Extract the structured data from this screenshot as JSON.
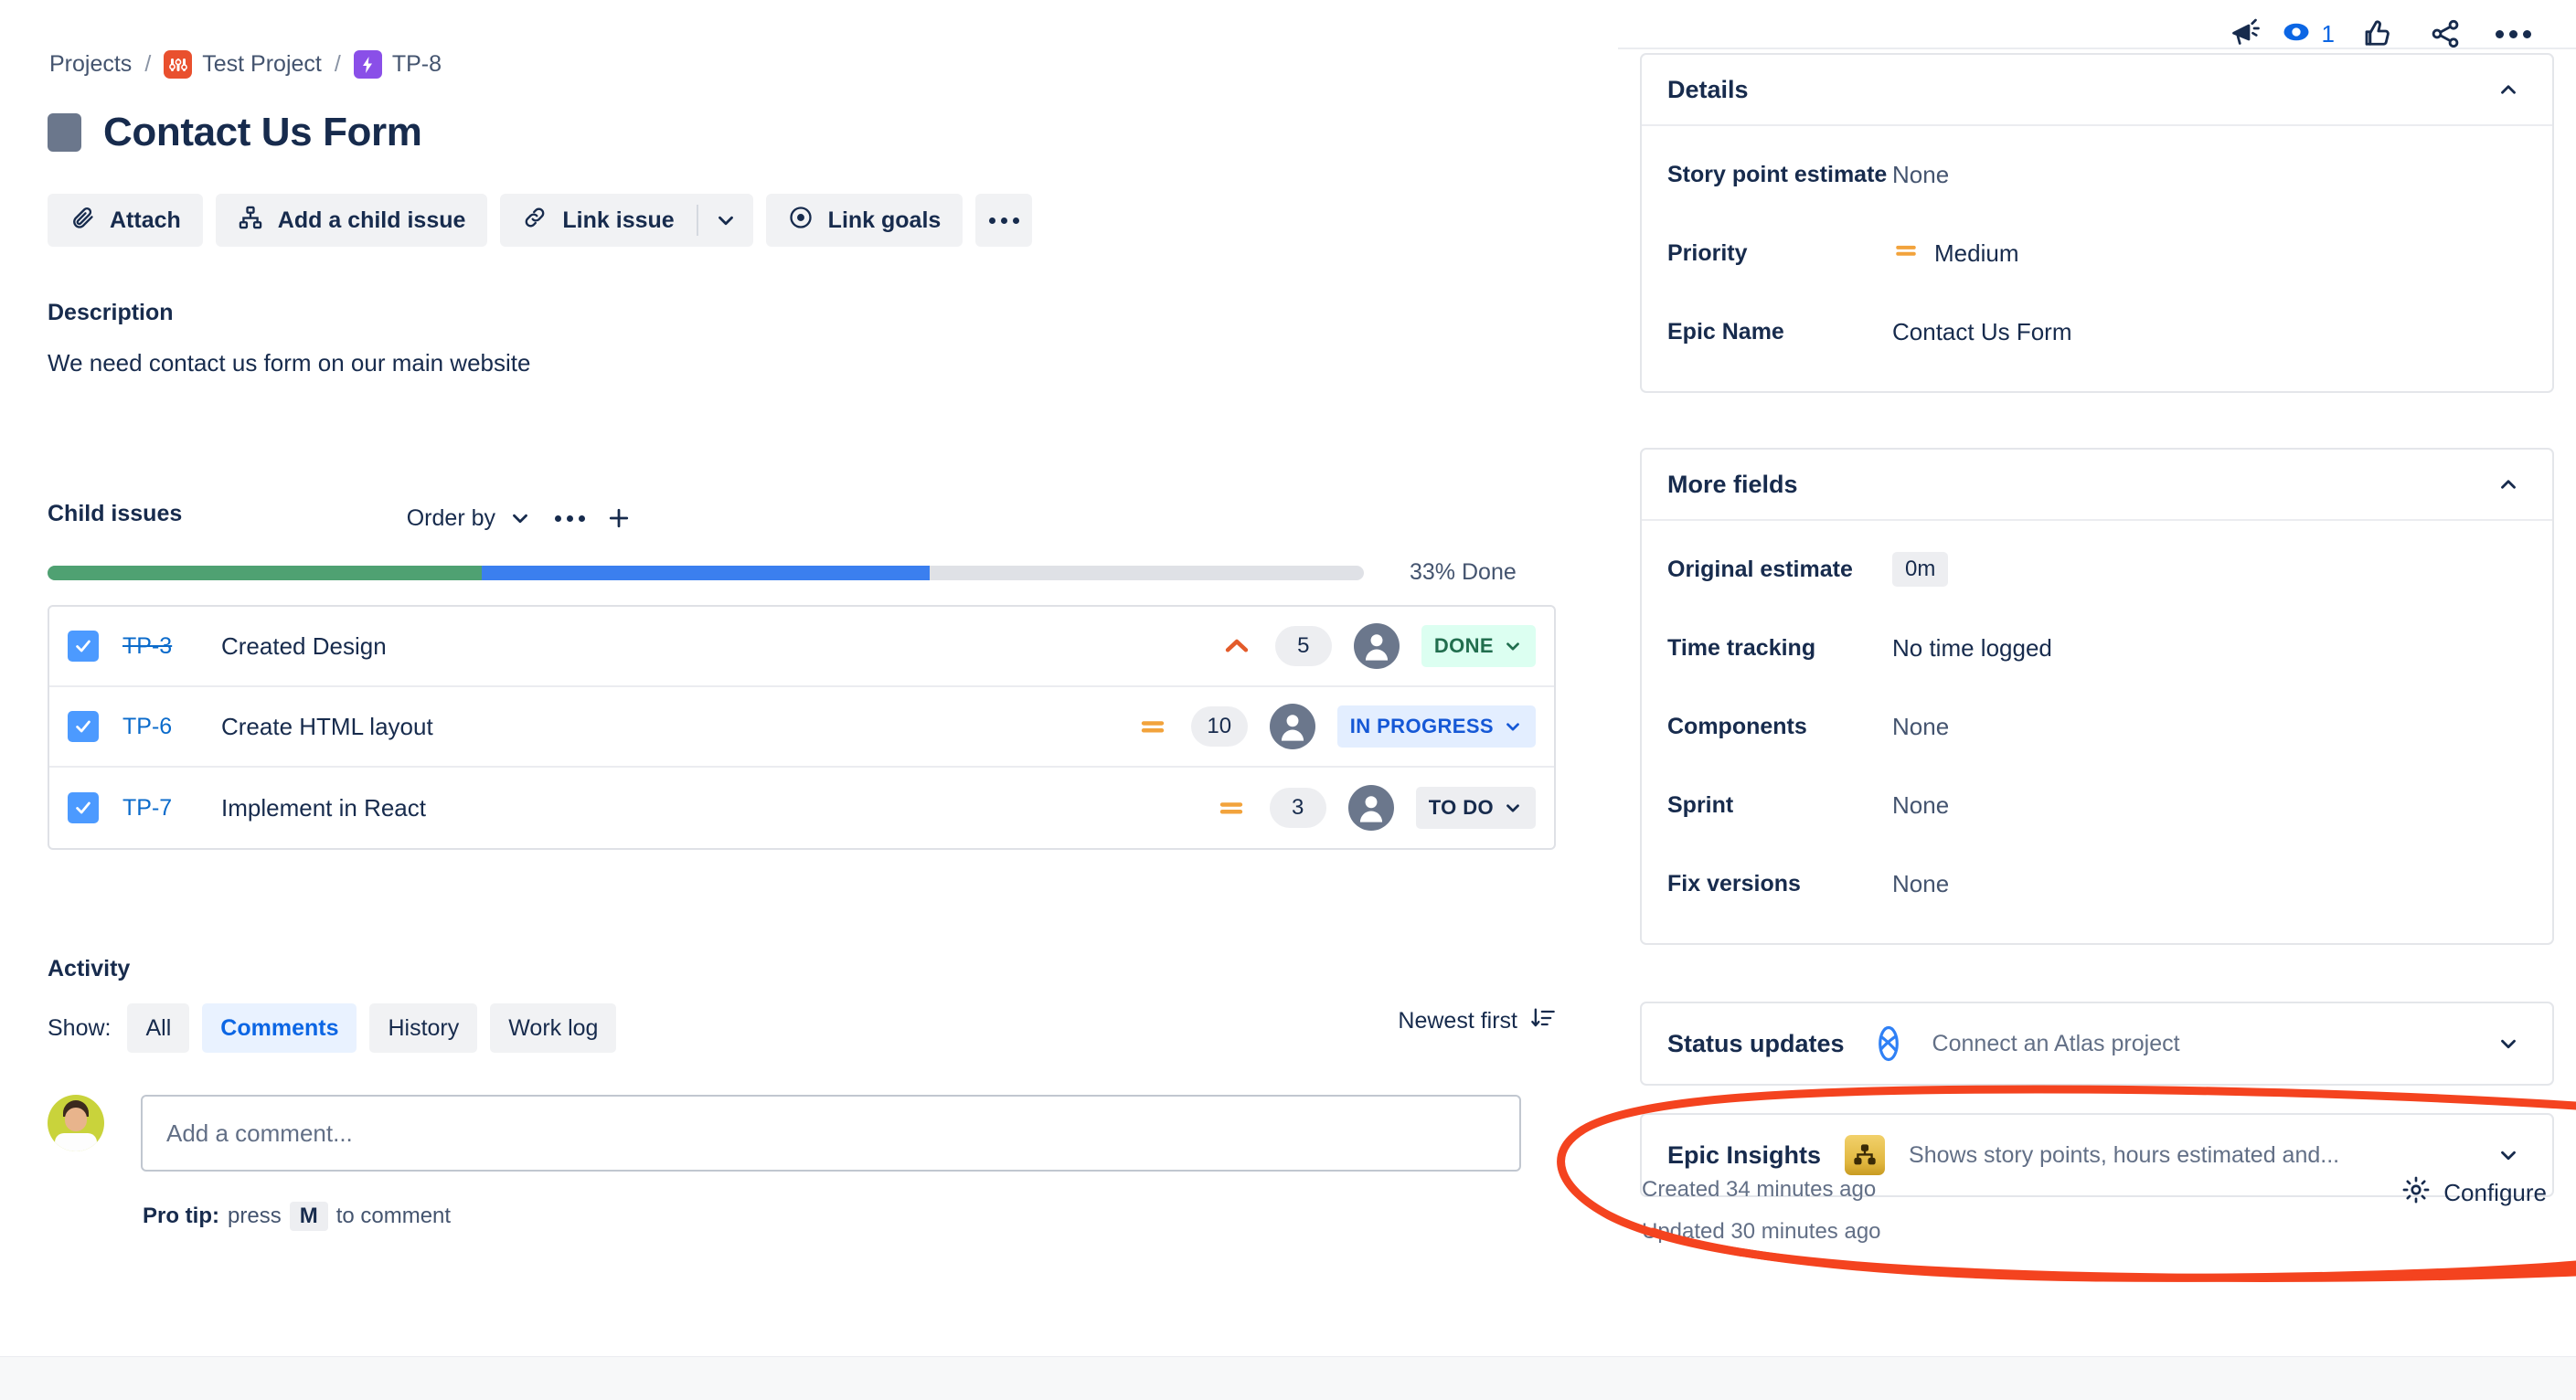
{
  "breadcrumb": {
    "projects_label": "Projects",
    "sep": "/",
    "project_name": "Test Project",
    "issue_key": "TP-8",
    "project_icon": "project-board-icon",
    "epic_icon": "epic-bolt-icon"
  },
  "header": {
    "title": "Contact Us Form",
    "type_icon": "epic-square-icon"
  },
  "toolbar": {
    "attach_label": "Attach",
    "attach_icon": "paperclip-icon",
    "add_child_label": "Add a child issue",
    "add_child_icon": "child-issue-tree-icon",
    "link_issue_label": "Link issue",
    "link_issue_icon": "link-chain-icon",
    "link_caret_icon": "chevron-down-icon",
    "link_goals_label": "Link goals",
    "link_goals_icon": "goal-target-icon",
    "more_icon": "more-horizontal-icon"
  },
  "top_right_icons": {
    "megaphone": "megaphone-icon",
    "watch": "watch-eye-icon",
    "watch_count": "1",
    "like": "thumbs-up-icon",
    "share": "share-icon",
    "more": "more-horizontal-icon"
  },
  "description": {
    "label": "Description",
    "text": "We need contact us form on our main website"
  },
  "child_issues": {
    "label": "Child issues",
    "order_by_label": "Order by",
    "order_by_caret_icon": "chevron-down-icon",
    "more_icon": "more-horizontal-icon",
    "add_icon": "plus-icon",
    "progress_done_label": "33% Done",
    "progress": {
      "green_pct": 33,
      "blue_pct": 34,
      "grey_pct": 33
    },
    "rows": [
      {
        "key": "TP-3",
        "key_strikethrough": true,
        "summary": "Created Design",
        "priority": "High",
        "priority_icon": "priority-high-icon",
        "points": "5",
        "assignee_icon": "user-avatar-icon",
        "status": "DONE",
        "status_style": "st-done",
        "checkbox_icon": "checkbox-checked-icon"
      },
      {
        "key": "TP-6",
        "key_strikethrough": false,
        "summary": "Create HTML layout",
        "priority": "Medium",
        "priority_icon": "priority-medium-icon",
        "points": "10",
        "assignee_icon": "user-avatar-icon",
        "status": "IN PROGRESS",
        "status_style": "st-prog",
        "checkbox_icon": "checkbox-checked-icon"
      },
      {
        "key": "TP-7",
        "key_strikethrough": false,
        "summary": "Implement in React",
        "priority": "Medium",
        "priority_icon": "priority-medium-icon",
        "points": "3",
        "assignee_icon": "user-avatar-icon",
        "status": "TO DO",
        "status_style": "st-todo",
        "checkbox_icon": "checkbox-checked-icon"
      }
    ]
  },
  "activity": {
    "label": "Activity",
    "show_label": "Show:",
    "filters": [
      {
        "label": "All",
        "active": false
      },
      {
        "label": "Comments",
        "active": true
      },
      {
        "label": "History",
        "active": false
      },
      {
        "label": "Work log",
        "active": false
      }
    ],
    "sort_label": "Newest first",
    "sort_icon": "sort-descending-icon",
    "comment_placeholder": "Add a comment...",
    "avatar_icon": "user-photo-avatar",
    "protip_prefix": "Pro tip:",
    "protip_mid": "press",
    "protip_key": "M",
    "protip_suffix": "to comment"
  },
  "details_card": {
    "title": "Details",
    "collapse_icon": "chevron-up-icon",
    "fields": [
      {
        "label": "Story point estimate",
        "value": "None",
        "icon": "",
        "pill": false
      },
      {
        "label": "Priority",
        "value": "Medium",
        "icon": "priority-medium-icon",
        "pill": false
      },
      {
        "label": "Epic Name",
        "value": "Contact Us Form",
        "icon": "",
        "pill": false
      }
    ]
  },
  "more_fields_card": {
    "title": "More fields",
    "collapse_icon": "chevron-up-icon",
    "fields": [
      {
        "label": "Original estimate",
        "value": "0m",
        "icon": "",
        "pill": true
      },
      {
        "label": "Time tracking",
        "value": "No time logged",
        "icon": "",
        "pill": false
      },
      {
        "label": "Components",
        "value": "None",
        "icon": "",
        "pill": false
      },
      {
        "label": "Sprint",
        "value": "None",
        "icon": "",
        "pill": false
      },
      {
        "label": "Fix versions",
        "value": "None",
        "icon": "",
        "pill": false
      }
    ]
  },
  "status_updates": {
    "title": "Status updates",
    "icon": "atlas-project-icon",
    "description": "Connect an Atlas project",
    "expand_icon": "chevron-down-icon"
  },
  "epic_insights": {
    "title": "Epic Insights",
    "icon": "epic-insights-tree-icon",
    "description": "Shows story points, hours estimated and...",
    "expand_icon": "chevron-down-icon"
  },
  "footer": {
    "created": "Created 34 minutes ago",
    "updated": "Updated 30 minutes ago",
    "configure_label": "Configure",
    "configure_icon": "gear-icon"
  },
  "annotation": {
    "color": "#F4431F",
    "shape": "hand-drawn-ellipse-circling-epic-insights"
  }
}
